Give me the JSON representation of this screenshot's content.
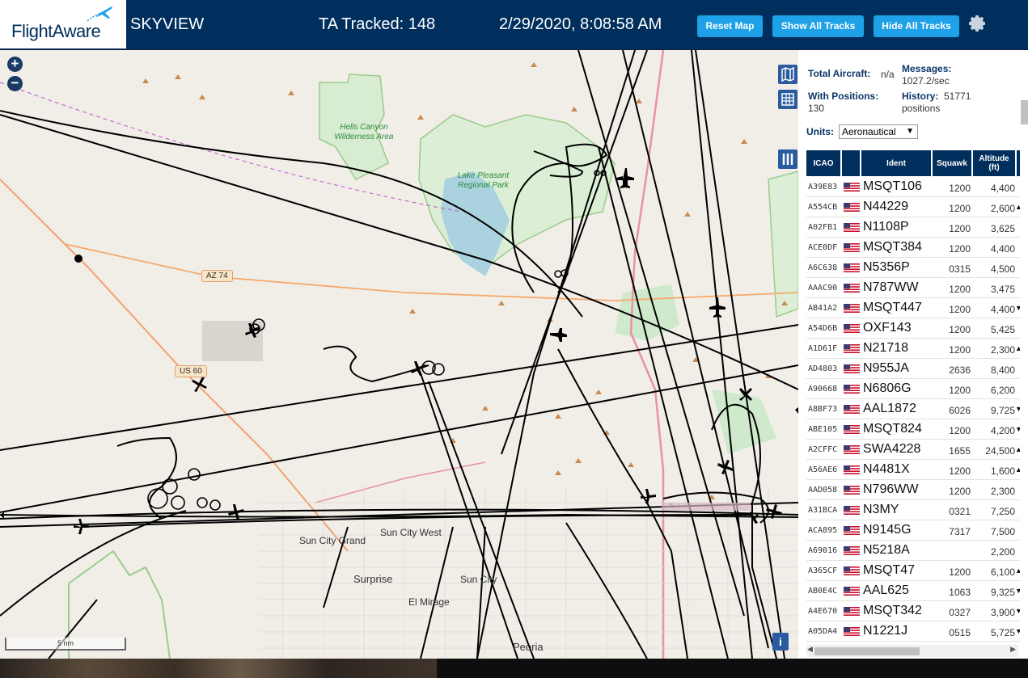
{
  "header": {
    "logo_text": "FlightAware",
    "app_title": "SKYVIEW",
    "ta_tracked": "TA Tracked: 148",
    "datetime": "2/29/2020, 8:08:58 AM",
    "buttons": {
      "reset_map": "Reset Map",
      "show_all_tracks": "Show All Tracks",
      "hide_all_tracks": "Hide All Tracks"
    },
    "settings_icon": "gear-icon"
  },
  "map": {
    "zoom_in": "+",
    "zoom_out": "−",
    "scale": "5 nm",
    "info": "i",
    "labels": {
      "hells_canyon": "Hells Canyon Wilderness Area",
      "lake_pleasant": "Lake Pleasant Regional Park",
      "az74": "AZ 74",
      "us60": "US 60",
      "sun_city_grand": "Sun City Grand",
      "sun_city_west": "Sun City West",
      "surprise": "Surprise",
      "sun_city": "Sun City",
      "el_mirage": "El Mirage",
      "peoria": "Peoria"
    },
    "colors": {
      "land": "#f1eee8",
      "water": "#aad3df",
      "park": "#c8e6c0",
      "track": "#000000",
      "highway": "#e892a2",
      "secondary": "#f6a96b"
    }
  },
  "sidebar": {
    "total_aircraft_label": "Total Aircraft:",
    "total_aircraft_value": "n/a",
    "messages_label": "Messages:",
    "messages_value": "1027.2/sec",
    "with_positions_label": "With Positions:",
    "with_positions_value": "130",
    "history_label": "History:",
    "history_value": "51771",
    "history_unit": "positions",
    "units_label": "Units:",
    "units_value": "Aeronautical",
    "columns": [
      "ICAO",
      "",
      "Ident",
      "Squawk",
      "Altitude (ft)"
    ],
    "rows": [
      {
        "icao": "A39E83",
        "ident": "MSQT106",
        "squawk": "1200",
        "alt": "4,400",
        "trend": ""
      },
      {
        "icao": "A554CB",
        "ident": "N44229",
        "squawk": "1200",
        "alt": "2,600",
        "trend": "▲"
      },
      {
        "icao": "A02FB1",
        "ident": "N1108P",
        "squawk": "1200",
        "alt": "3,625",
        "trend": ""
      },
      {
        "icao": "ACE0DF",
        "ident": "MSQT384",
        "squawk": "1200",
        "alt": "4,400",
        "trend": ""
      },
      {
        "icao": "A6C638",
        "ident": "N5356P",
        "squawk": "0315",
        "alt": "4,500",
        "trend": ""
      },
      {
        "icao": "AAAC90",
        "ident": "N787WW",
        "squawk": "1200",
        "alt": "3,475",
        "trend": ""
      },
      {
        "icao": "AB41A2",
        "ident": "MSQT447",
        "squawk": "1200",
        "alt": "4,400",
        "trend": "▼"
      },
      {
        "icao": "A54D6B",
        "ident": "OXF143",
        "squawk": "1200",
        "alt": "5,425",
        "trend": ""
      },
      {
        "icao": "A1D61F",
        "ident": "N21718",
        "squawk": "1200",
        "alt": "2,300",
        "trend": "▲"
      },
      {
        "icao": "AD4803",
        "ident": "N955JA",
        "squawk": "2636",
        "alt": "8,400",
        "trend": ""
      },
      {
        "icao": "A90668",
        "ident": "N6806G",
        "squawk": "1200",
        "alt": "6,200",
        "trend": ""
      },
      {
        "icao": "A8BF73",
        "ident": "AAL1872",
        "squawk": "6026",
        "alt": "9,725",
        "trend": "▼"
      },
      {
        "icao": "ABE105",
        "ident": "MSQT824",
        "squawk": "1200",
        "alt": "4,200",
        "trend": "▼"
      },
      {
        "icao": "A2CFFC",
        "ident": "SWA4228",
        "squawk": "1655",
        "alt": "24,500",
        "trend": "▲"
      },
      {
        "icao": "A56AE6",
        "ident": "N4481X",
        "squawk": "1200",
        "alt": "1,600",
        "trend": "▲"
      },
      {
        "icao": "AAD058",
        "ident": "N796WW",
        "squawk": "1200",
        "alt": "2,300",
        "trend": ""
      },
      {
        "icao": "A31BCA",
        "ident": "N3MY",
        "squawk": "0321",
        "alt": "7,250",
        "trend": ""
      },
      {
        "icao": "ACA895",
        "ident": "N9145G",
        "squawk": "7317",
        "alt": "7,500",
        "trend": ""
      },
      {
        "icao": "A69016",
        "ident": "N5218A",
        "squawk": "",
        "alt": "2,200",
        "trend": ""
      },
      {
        "icao": "A365CF",
        "ident": "MSQT47",
        "squawk": "1200",
        "alt": "6,100",
        "trend": "▲"
      },
      {
        "icao": "AB0E4C",
        "ident": "AAL625",
        "squawk": "1063",
        "alt": "9,325",
        "trend": "▼"
      },
      {
        "icao": "A4E670",
        "ident": "MSQT342",
        "squawk": "0327",
        "alt": "3,900",
        "trend": "▼"
      },
      {
        "icao": "A05DA4",
        "ident": "N1221J",
        "squawk": "0515",
        "alt": "5,725",
        "trend": "▼"
      }
    ]
  }
}
